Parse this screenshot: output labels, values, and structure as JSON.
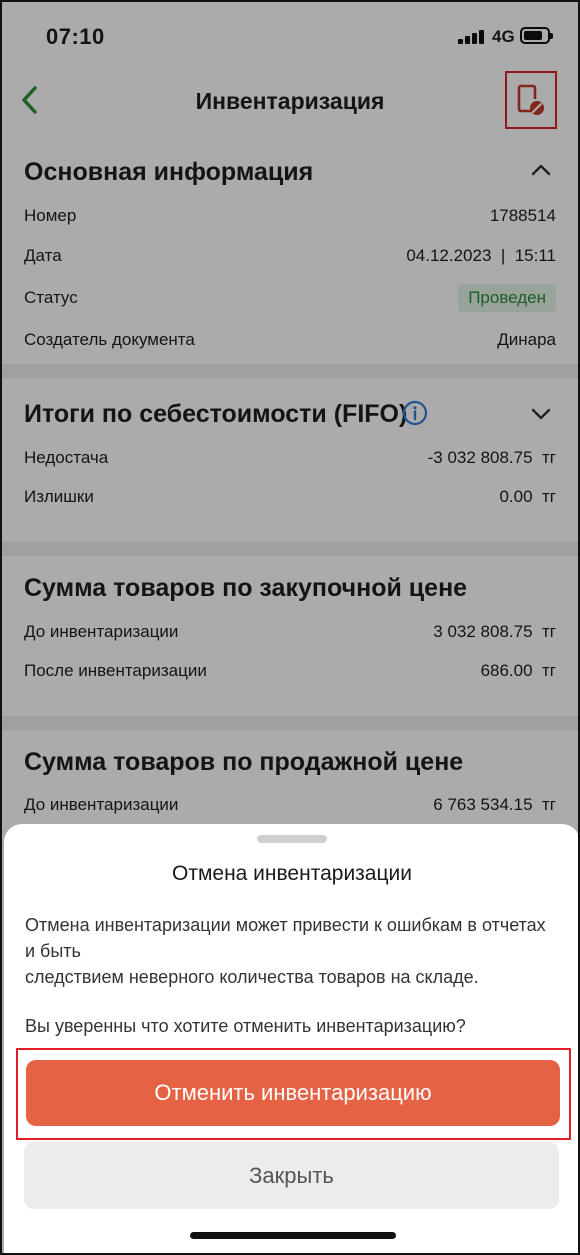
{
  "status_bar": {
    "time": "07:10",
    "network": "4G"
  },
  "header": {
    "title": "Инвентаризация"
  },
  "basic_info": {
    "title": "Основная информация",
    "rows": [
      {
        "label": "Номер",
        "value": "1788514"
      },
      {
        "label": "Дата",
        "value": "04.12.2023  |  15:11"
      },
      {
        "label": "Статус",
        "value": "Проведен"
      },
      {
        "label": "Создатель документа",
        "value": "Динара"
      }
    ]
  },
  "cost_totals": {
    "title": "Итоги по себестоимости (FIFO)",
    "rows": [
      {
        "label": "Недостача",
        "value": "-3 032 808.75  тг"
      },
      {
        "label": "Излишки",
        "value": "0.00  тг"
      }
    ]
  },
  "purchase_sum": {
    "title": "Сумма товаров по закупочной цене",
    "rows": [
      {
        "label": "До инвентаризации",
        "value": "3 032 808.75  тг"
      },
      {
        "label": "После инвентаризации",
        "value": "686.00  тг"
      }
    ]
  },
  "sale_sum": {
    "title": "Сумма товаров по продажной цене",
    "rows": [
      {
        "label": "До инвентаризации",
        "value": "6 763 534.15  тг"
      }
    ]
  },
  "sheet": {
    "title": "Отмена инвентаризации",
    "text_line1": "Отмена инвентаризации может привести к ошибкам в отчетах и быть",
    "text_line2": "следствием неверного количества товаров на складе.",
    "question": "Вы уверенны что хотите отменить инвентаризацию?",
    "confirm_label": "Отменить инвентаризацию",
    "close_label": "Закрыть"
  },
  "colors": {
    "accent_green": "#2f8d3b",
    "danger": "#e56245",
    "highlight_red": "#e21f26",
    "icon_red": "#c0392b"
  }
}
